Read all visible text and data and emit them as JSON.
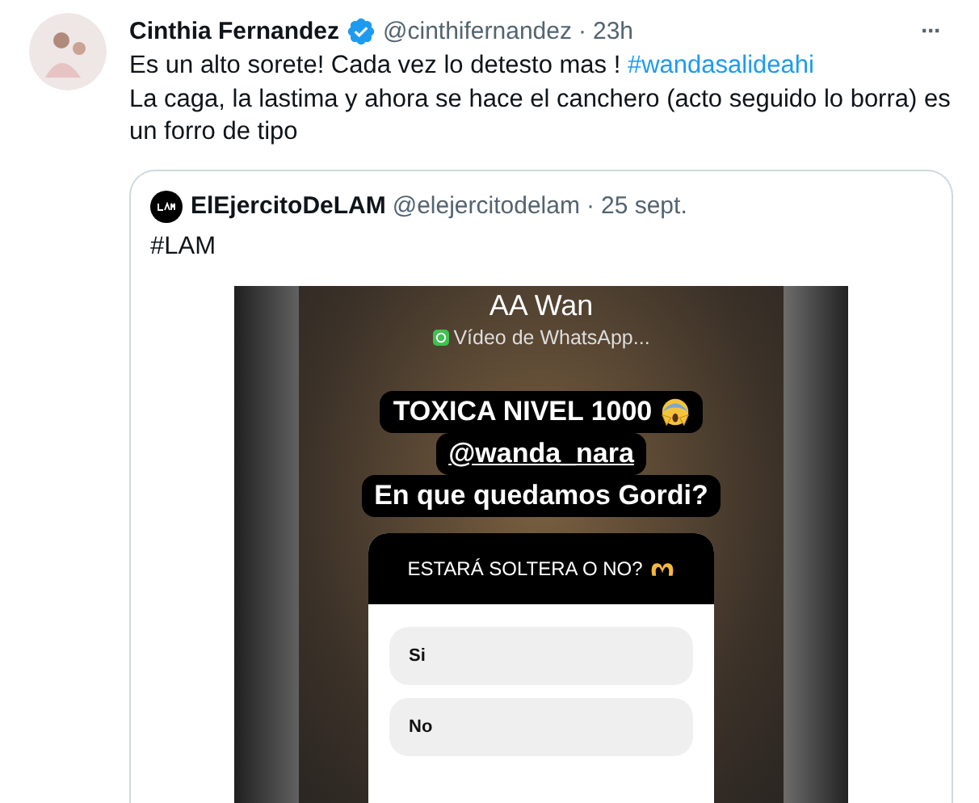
{
  "tweet": {
    "author": "Cinthia Fernandez",
    "verified": true,
    "handle": "@cinthifernandez",
    "separator": "·",
    "time": "23h",
    "more": "···",
    "lines": [
      [
        {
          "text": "Es un alto sorete! Cada vez lo detesto mas ! ",
          "kind": "plain"
        },
        {
          "text": "#wandasalideahi",
          "kind": "hashtag"
        }
      ],
      [
        {
          "text": "La caga, la lastima y ahora se hace el canchero (acto seguido lo borra) es un forro de tipo",
          "kind": "plain"
        }
      ]
    ]
  },
  "quote": {
    "author": "ElEjercitoDeLAM",
    "handle": "@elejercitodelam",
    "separator": "·",
    "date": "25 sept.",
    "text": "#LAM",
    "story": {
      "title": "AA Wan",
      "subtitle": "Vídeo de WhatsApp...",
      "stickers": [
        "TOXICA NIVEL 1000",
        "@wanda_nara",
        "En que quedamos Gordi?"
      ],
      "poll": {
        "question": "ESTARÁ SOLTERA O NO?",
        "options": [
          "Si",
          "No"
        ]
      }
    }
  }
}
